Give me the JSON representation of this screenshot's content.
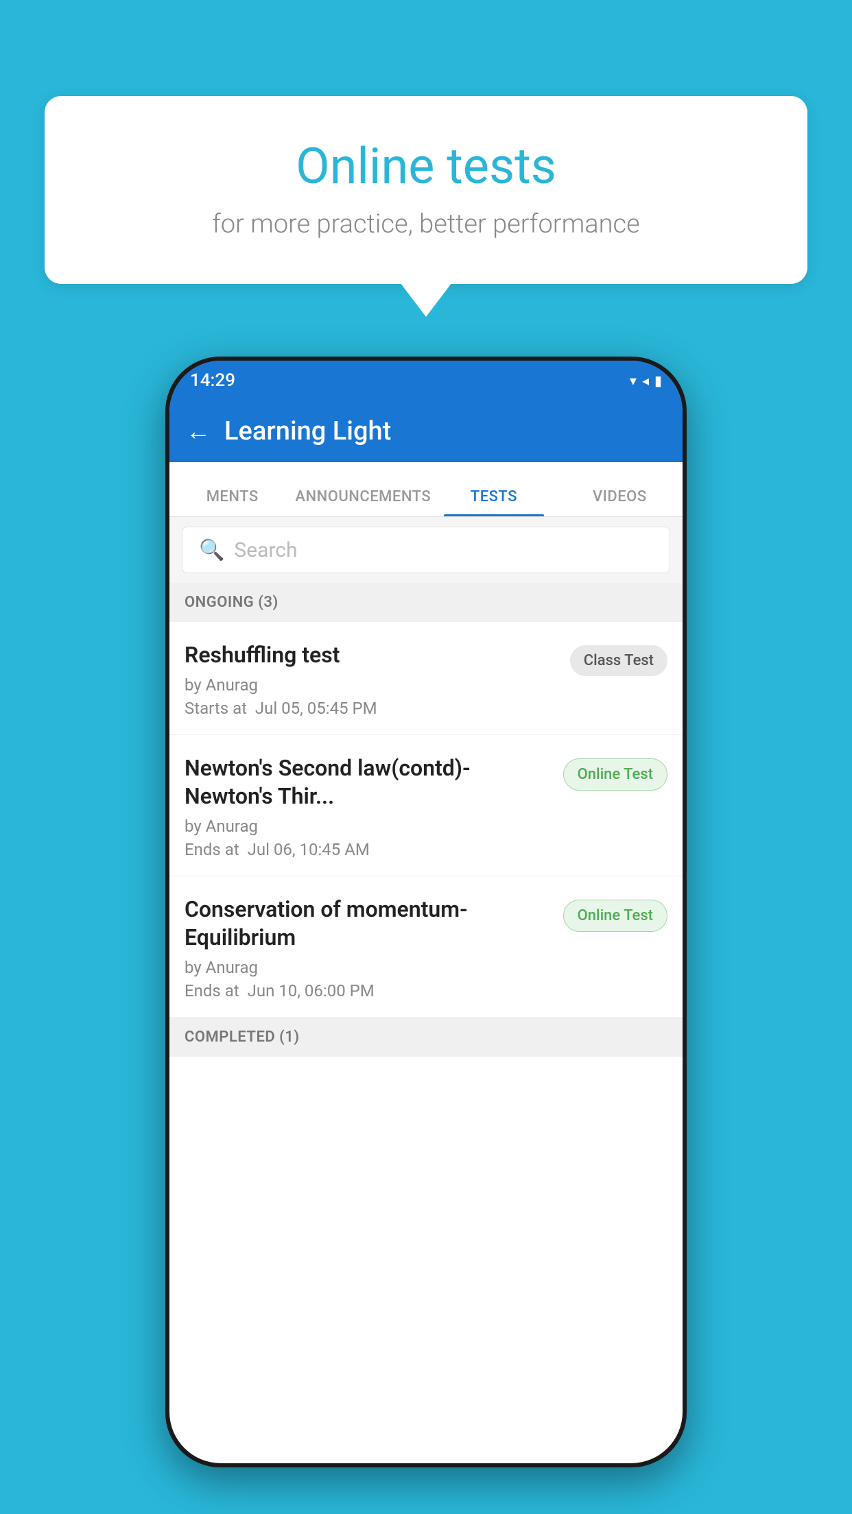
{
  "background_color": "#29B6D8",
  "speech_bubble": {
    "title": "Online tests",
    "subtitle": "for more practice, better performance"
  },
  "phone": {
    "status_bar": {
      "time": "14:29",
      "icons": "▾◂▮"
    },
    "app_bar": {
      "title": "Learning Light",
      "back_label": "←"
    },
    "tabs": [
      {
        "label": "MENTS",
        "active": false
      },
      {
        "label": "ANNOUNCEMENTS",
        "active": false
      },
      {
        "label": "TESTS",
        "active": true
      },
      {
        "label": "VIDEOS",
        "active": false
      }
    ],
    "search": {
      "placeholder": "Search"
    },
    "sections": [
      {
        "header": "ONGOING (3)",
        "items": [
          {
            "title": "Reshuffling test",
            "author": "by Anurag",
            "time_label": "Starts at",
            "time_value": "Jul 05, 05:45 PM",
            "badge": "Class Test",
            "badge_type": "class"
          },
          {
            "title": "Newton's Second law(contd)-Newton's Thir...",
            "author": "by Anurag",
            "time_label": "Ends at",
            "time_value": "Jul 06, 10:45 AM",
            "badge": "Online Test",
            "badge_type": "online"
          },
          {
            "title": "Conservation of momentum-Equilibrium",
            "author": "by Anurag",
            "time_label": "Ends at",
            "time_value": "Jun 10, 06:00 PM",
            "badge": "Online Test",
            "badge_type": "online"
          }
        ]
      },
      {
        "header": "COMPLETED (1)",
        "items": []
      }
    ]
  }
}
